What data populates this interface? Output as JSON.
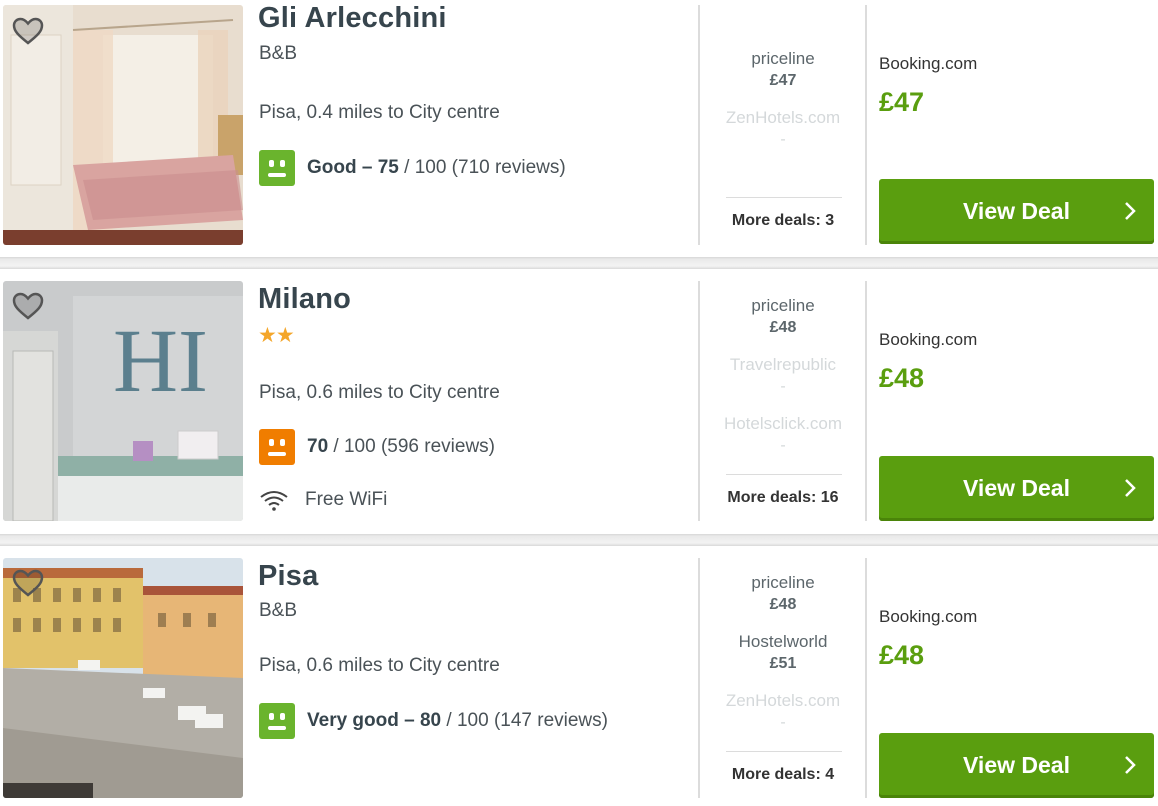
{
  "listings": [
    {
      "name": "Gli Arlecchini",
      "subtype": "B&B",
      "location": "Pisa, 0.4 miles to City centre",
      "rating_label": "Good – 75",
      "rating_rest": " / 100 (710 reviews)",
      "rating_color": "#6ab42d",
      "deals": [
        {
          "provider": "priceline",
          "price": "£47",
          "faded": false
        },
        {
          "provider": "ZenHotels.com",
          "price": "-",
          "faded": true
        }
      ],
      "more_deals": "More deals: 3",
      "best_provider": "Booking.com",
      "best_price": "£47",
      "cta": "View Deal"
    },
    {
      "name": "Milano",
      "stars": "★★",
      "location": "Pisa, 0.6 miles to City centre",
      "rating_label": "70",
      "rating_rest": " / 100 (596 reviews)",
      "rating_color": "#f07d00",
      "amenity": "Free WiFi",
      "deals": [
        {
          "provider": "priceline",
          "price": "£48",
          "faded": false
        },
        {
          "provider": "Travelrepublic",
          "price": "-",
          "faded": true
        },
        {
          "provider": "Hotelsclick.com",
          "price": "-",
          "faded": true
        }
      ],
      "more_deals": "More deals: 16",
      "best_provider": "Booking.com",
      "best_price": "£48",
      "cta": "View Deal"
    },
    {
      "name": "Pisa",
      "subtype": "B&B",
      "location": "Pisa, 0.6 miles to City centre",
      "rating_label": "Very good – 80",
      "rating_rest": " / 100 (147 reviews)",
      "rating_color": "#6ab42d",
      "deals": [
        {
          "provider": "priceline",
          "price": "£48",
          "faded": false
        },
        {
          "provider": "Hostelworld",
          "price": "£51",
          "faded": false
        },
        {
          "provider": "ZenHotels.com",
          "price": "-",
          "faded": true
        }
      ],
      "more_deals": "More deals: 4",
      "best_provider": "Booking.com",
      "best_price": "£48",
      "cta": "View Deal"
    }
  ],
  "colors": {
    "accent_green": "#5a9e0f",
    "rating_good": "#6ab42d",
    "rating_orange": "#f07d00",
    "star": "#f4a62a"
  }
}
